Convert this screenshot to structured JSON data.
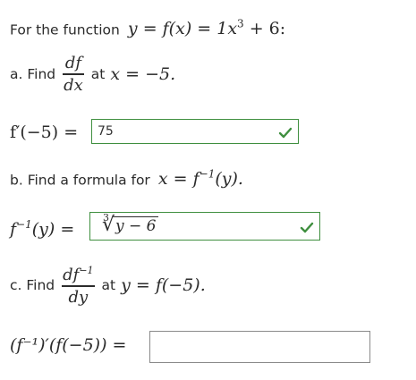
{
  "intro": {
    "text": "For the function"
  },
  "function_def": {
    "lhs": "y = f(x) = 1x",
    "exp": "3",
    "rhs": " + 6:"
  },
  "part_a": {
    "label": "a. Find",
    "frac_num": "df",
    "frac_den": "dx",
    "at_text": "at",
    "at_math": "x = −5.",
    "answer_prefix": "f′(−5) =",
    "answer_value": "75",
    "status": "correct"
  },
  "part_b": {
    "prompt": "b. Find a formula for",
    "prompt_math_base": "x = f",
    "prompt_math_exp": "−1",
    "prompt_math_tail": "(y).",
    "answer_prefix_base": "f",
    "answer_prefix_exp": "−1",
    "answer_prefix_tail": "(y) =",
    "root_index": "3",
    "radicand": "y − 6",
    "status": "correct"
  },
  "part_c": {
    "label": "c. Find",
    "frac_num_base": "df",
    "frac_num_exp": "−1",
    "frac_den": "dy",
    "at_text": "at",
    "at_math": "y = f(−5).",
    "answer_prefix": "(f⁻¹)′(f(−5)) =",
    "answer_value": ""
  },
  "colors": {
    "correct": "#3f8f3f",
    "text": "#2b2b2b"
  },
  "icons": {
    "status_correct": "check-icon"
  }
}
